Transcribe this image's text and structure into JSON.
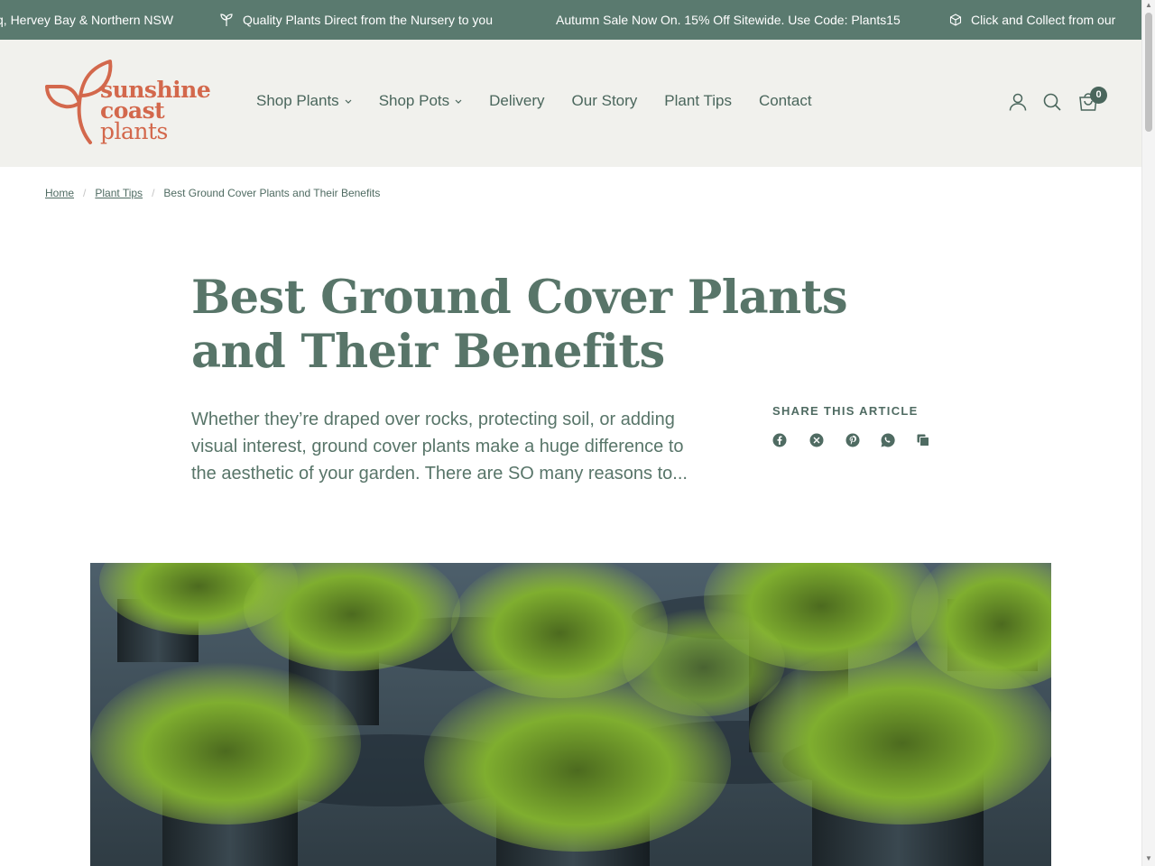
{
  "announcement": {
    "msg1": "q, Hervey Bay & Northern NSW",
    "msg2": "Quality Plants Direct from the Nursery to you",
    "msg3": "Autumn Sale Now On. 15% Off Sitewide. Use Code: Plants15",
    "msg4": "Click and Collect from our"
  },
  "logo": {
    "line1": "sunshine",
    "line2": "coast",
    "line3": "plants"
  },
  "nav": [
    {
      "label": "Shop Plants",
      "dropdown": true
    },
    {
      "label": "Shop Pots",
      "dropdown": true
    },
    {
      "label": "Delivery"
    },
    {
      "label": "Our Story"
    },
    {
      "label": "Plant Tips"
    },
    {
      "label": "Contact"
    }
  ],
  "header_icons": {
    "account": "user-icon",
    "search": "search-icon",
    "cart": "cart-icon",
    "cart_count": "0"
  },
  "breadcrumb": {
    "home": "Home",
    "section": "Plant Tips",
    "current": "Best Ground Cover Plants and Their Benefits"
  },
  "article": {
    "title": "Best Ground Cover Plants and Their Benefits",
    "excerpt": "Whether they’re draped over rocks, protecting soil, or adding visual interest, ground cover plants make a huge difference to the aesthetic of your garden. There are SO many reasons to..."
  },
  "share": {
    "label": "SHARE THIS ARTICLE",
    "icons": [
      "facebook-icon",
      "x-icon",
      "pinterest-icon",
      "whatsapp-icon",
      "copy-link-icon"
    ]
  },
  "colors": {
    "brand_green": "#5a7a6f",
    "logo_orange": "#d3684c",
    "header_bg": "#f1f1ed"
  }
}
